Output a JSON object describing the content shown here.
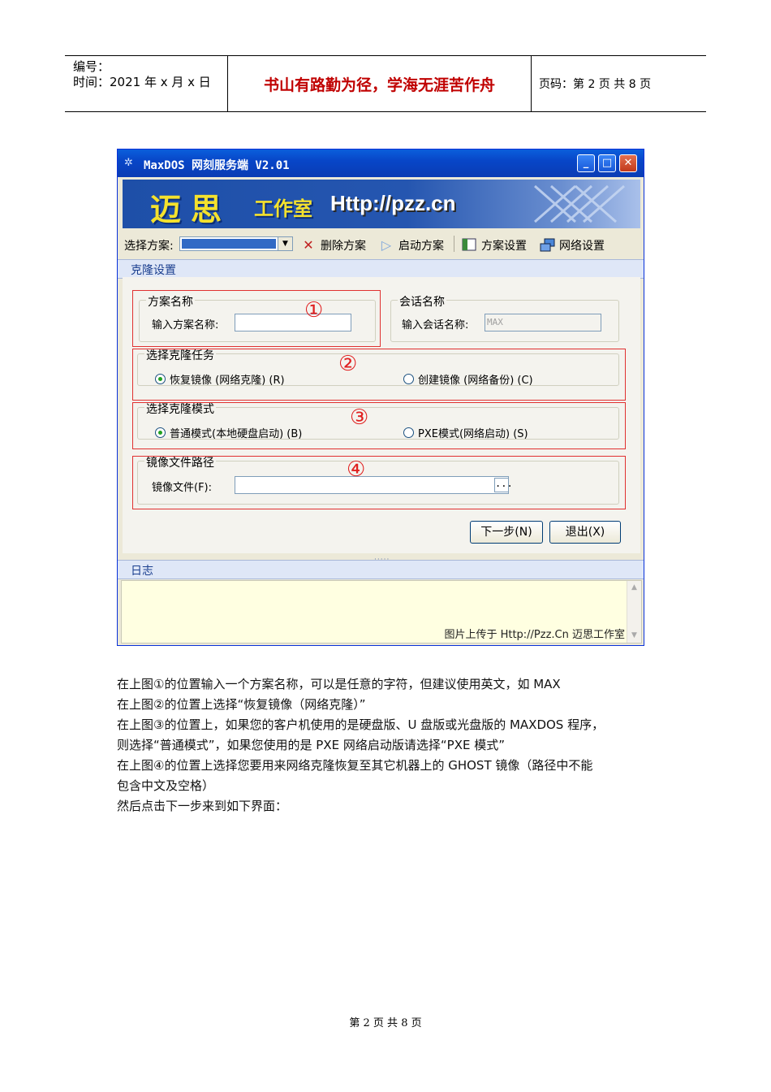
{
  "header": {
    "code_label": "编号：",
    "time_label": "时间：2021 年 x 月 x 日",
    "motto": "书山有路勤为径，学海无涯苦作舟",
    "page_info": "页码：第 2 页  共 8 页"
  },
  "window": {
    "title": "MaxDOS 网刻服务端 V2.01",
    "banner_logo": "迈思",
    "banner_studio": "工作室",
    "banner_url": "Http://pzz.cn",
    "toolbar": {
      "select_label": "选择方案:",
      "delete": "删除方案",
      "start": "启动方案",
      "scheme_settings": "方案设置",
      "network_settings": "网络设置"
    },
    "clone_section": "克隆设置",
    "scheme_group": {
      "legend": "方案名称",
      "label": "输入方案名称:",
      "value": ""
    },
    "session_group": {
      "legend": "会话名称",
      "label": "输入会话名称:",
      "value": "MAX"
    },
    "task_group": {
      "legend": "选择克隆任务",
      "option1": "恢复镜像 (网络克隆) (R)",
      "option2": "创建镜像 (网络备份) (C)"
    },
    "mode_group": {
      "legend": "选择克隆模式",
      "option1": "普通模式(本地硬盘启动) (B)",
      "option2": "PXE模式(网络启动) (S)"
    },
    "path_group": {
      "legend": "镜像文件路径",
      "label": "镜像文件(F):",
      "browse": "..."
    },
    "markers": [
      "①",
      "②",
      "③",
      "④"
    ],
    "next_button": "下一步(N)",
    "exit_button": "退出(X)",
    "log_section": "日志",
    "watermark": "图片上传于 Http://Pzz.Cn 迈思工作室"
  },
  "paragraphs": [
    "在上图①的位置输入一个方案名称，可以是任意的字符，但建议使用英文，如 MAX",
    "在上图②的位置上选择“恢复镜像（网络克隆）”",
    "在上图③的位置上，如果您的客户机使用的是硬盘版、U 盘版或光盘版的 MAXDOS 程序，",
    "则选择“普通模式”，如果您使用的是 PXE 网络启动版请选择“PXE 模式”",
    "在上图④的位置上选择您要用来网络克隆恢复至其它机器上的 GHOST 镜像（路径中不能",
    "包含中文及空格）",
    "然后点击下一步来到如下界面："
  ],
  "footer": "第 2 页 共 8 页"
}
